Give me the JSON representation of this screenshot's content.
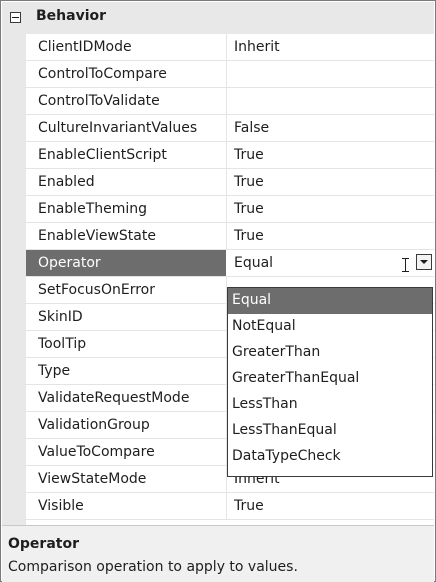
{
  "category": {
    "title": "Behavior"
  },
  "properties": [
    {
      "name": "ClientIDMode",
      "value": "Inherit"
    },
    {
      "name": "ControlToCompare",
      "value": ""
    },
    {
      "name": "ControlToValidate",
      "value": ""
    },
    {
      "name": "CultureInvariantValues",
      "value": "False"
    },
    {
      "name": "EnableClientScript",
      "value": "True"
    },
    {
      "name": "Enabled",
      "value": "True"
    },
    {
      "name": "EnableTheming",
      "value": "True"
    },
    {
      "name": "EnableViewState",
      "value": "True"
    },
    {
      "name": "Operator",
      "value": "Equal"
    },
    {
      "name": "SetFocusOnError",
      "value": ""
    },
    {
      "name": "SkinID",
      "value": ""
    },
    {
      "name": "ToolTip",
      "value": ""
    },
    {
      "name": "Type",
      "value": ""
    },
    {
      "name": "ValidateRequestMode",
      "value": ""
    },
    {
      "name": "ValidationGroup",
      "value": ""
    },
    {
      "name": "ValueToCompare",
      "value": ""
    },
    {
      "name": "ViewStateMode",
      "value": "Inherit"
    },
    {
      "name": "Visible",
      "value": "True"
    }
  ],
  "dropdown": {
    "options": [
      "Equal",
      "NotEqual",
      "GreaterThan",
      "GreaterThanEqual",
      "LessThan",
      "LessThanEqual",
      "DataTypeCheck"
    ],
    "selected": "Equal"
  },
  "description": {
    "title": "Operator",
    "text": "Comparison operation to apply to values."
  },
  "colors": {
    "selection": "#6d6d6d",
    "category_background": "#e8e8e8",
    "description_background": "#f0f0f0"
  }
}
